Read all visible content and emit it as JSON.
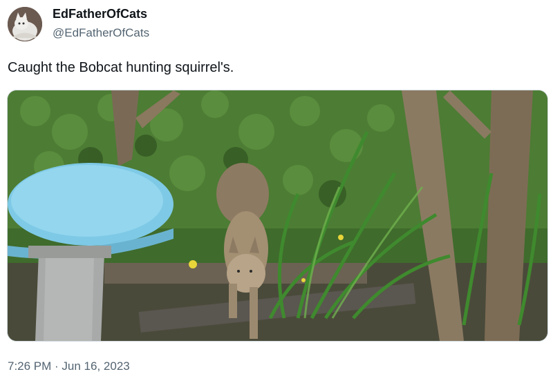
{
  "tweet": {
    "display_name": "EdFatherOfCats",
    "handle": "@EdFatherOfCats",
    "text": "Caught the Bobcat hunting squirrel's.",
    "timestamp": "7:26 PM · Jun 16, 2023"
  },
  "icons": {
    "avatar": "cat-avatar-icon"
  },
  "colors": {
    "text_primary": "#0f1419",
    "text_secondary": "#536471",
    "media_border": "#cfd9de"
  }
}
